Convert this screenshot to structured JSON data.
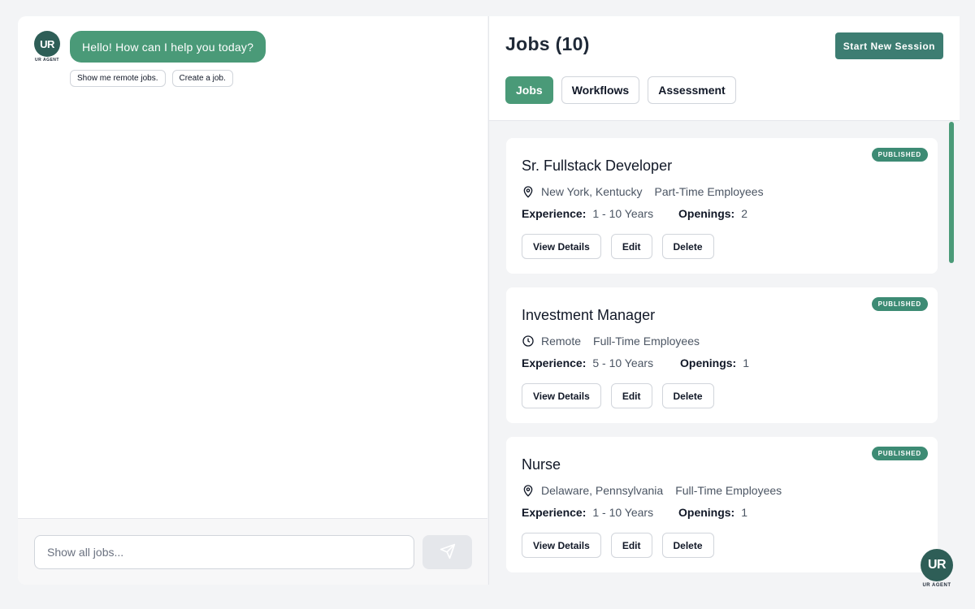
{
  "brand": {
    "logo_text": "UR",
    "logo_subtext": "UR AGENT",
    "accent": "#4a9a78"
  },
  "chat": {
    "greeting": "Hello! How can I help you today?",
    "suggestions": [
      "Show me remote jobs.",
      "Create a job."
    ],
    "input_placeholder": "Show all jobs...",
    "send_icon": "paper-plane-icon"
  },
  "jobs": {
    "title": "Jobs (10)",
    "start_session_label": "Start New Session",
    "tabs": [
      {
        "label": "Jobs",
        "active": true
      },
      {
        "label": "Workflows",
        "active": false
      },
      {
        "label": "Assessment",
        "active": false
      }
    ],
    "experience_label": "Experience:",
    "openings_label": "Openings:",
    "actions": {
      "view": "View Details",
      "edit": "Edit",
      "delete": "Delete"
    },
    "items": [
      {
        "status": "PUBLISHED",
        "title": "Sr. Fullstack Developer",
        "location_icon": "map-pin-icon",
        "location": "New York, Kentucky",
        "employment": "Part-Time Employees",
        "experience": "1 - 10 Years",
        "openings": "2"
      },
      {
        "status": "PUBLISHED",
        "title": "Investment Manager",
        "location_icon": "clock-icon",
        "location": "Remote",
        "employment": "Full-Time Employees",
        "experience": "5 - 10 Years",
        "openings": "1"
      },
      {
        "status": "PUBLISHED",
        "title": "Nurse",
        "location_icon": "map-pin-icon",
        "location": "Delaware, Pennsylvania",
        "employment": "Full-Time Employees",
        "experience": "1 - 10 Years",
        "openings": "1"
      }
    ]
  }
}
